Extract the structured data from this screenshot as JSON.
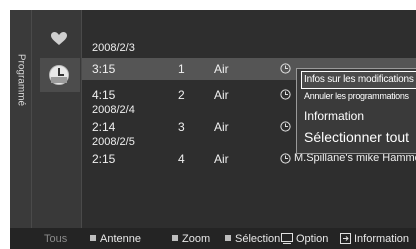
{
  "sidebar": {
    "tab_label": "Programmé",
    "icons": [
      "heart-icon",
      "clock-icon"
    ]
  },
  "schedule": {
    "dates": [
      "2008/2/3",
      "2008/2/4",
      "2008/2/5"
    ],
    "rows": [
      {
        "time": "3:15",
        "channel": "1",
        "antenna": "Air",
        "program": ""
      },
      {
        "time": "4:15",
        "channel": "2",
        "antenna": "Air",
        "program": ""
      },
      {
        "time": "2:14",
        "channel": "3",
        "antenna": "Air",
        "program": ""
      },
      {
        "time": "2:15",
        "channel": "4",
        "antenna": "Air",
        "program": "M.Spillane's mike Hammer"
      }
    ]
  },
  "popup_menu": {
    "items": [
      "Infos sur les modifications",
      "Annuler les programmations",
      "Information",
      "Sélectionner tout"
    ]
  },
  "help_bar": {
    "all": "Tous",
    "antenna": "Antenne",
    "zoom": "Zoom",
    "select": "Sélection",
    "option": "Option",
    "info": "Information"
  },
  "colors": {
    "panel_bg": "#2e2e2e",
    "selected_row": "#555555",
    "text": "#f0f0f0"
  }
}
